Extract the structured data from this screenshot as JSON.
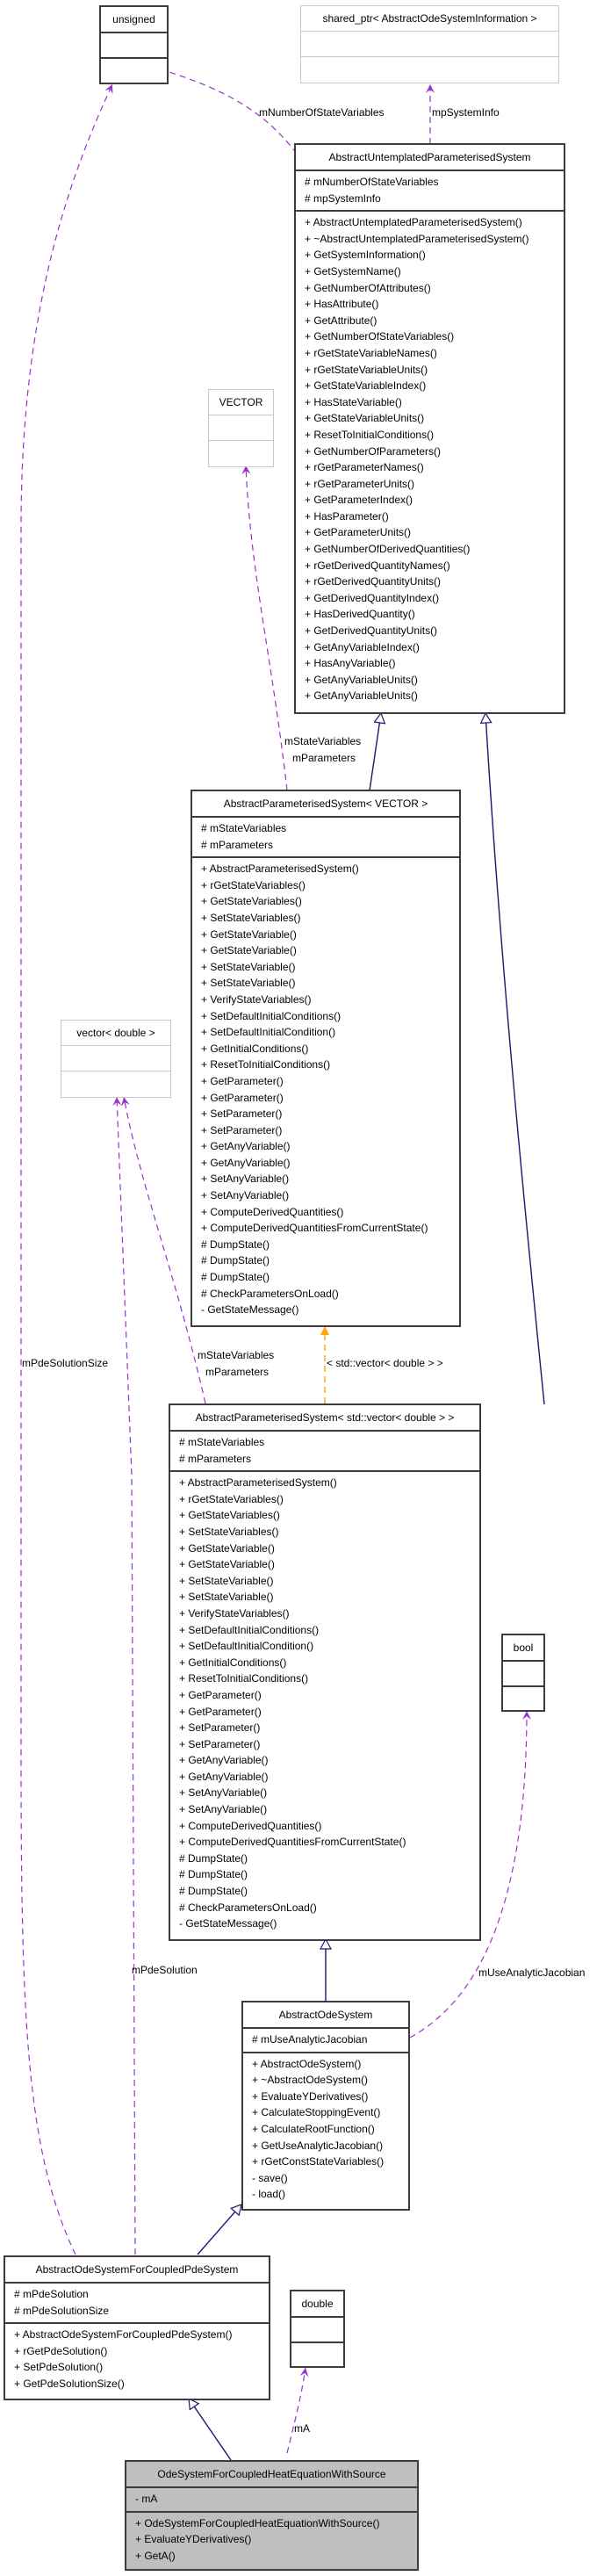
{
  "classes": {
    "unsigned": {
      "name": "unsigned",
      "attributes": [],
      "methods": []
    },
    "shared_ptr": {
      "name": "shared_ptr< AbstractOdeSystemInformation >",
      "attributes": [],
      "methods": []
    },
    "vector_tpl": {
      "name": "VECTOR",
      "attributes": [],
      "methods": []
    },
    "untemplated": {
      "name": "AbstractUntemplatedParameterisedSystem",
      "attributes": [
        "# mNumberOfStateVariables",
        "# mpSystemInfo"
      ],
      "methods": [
        "+ AbstractUntemplatedParameterisedSystem()",
        "+ ~AbstractUntemplatedParameterisedSystem()",
        "+ GetSystemInformation()",
        "+ GetSystemName()",
        "+ GetNumberOfAttributes()",
        "+ HasAttribute()",
        "+ GetAttribute()",
        "+ GetNumberOfStateVariables()",
        "+ rGetStateVariableNames()",
        "+ rGetStateVariableUnits()",
        "+ GetStateVariableIndex()",
        "+ HasStateVariable()",
        "+ GetStateVariableUnits()",
        "+ ResetToInitialConditions()",
        "+ GetNumberOfParameters()",
        "+ rGetParameterNames()",
        "+ rGetParameterUnits()",
        "+ GetParameterIndex()",
        "+ HasParameter()",
        "+ GetParameterUnits()",
        "+ GetNumberOfDerivedQuantities()",
        "+ rGetDerivedQuantityNames()",
        "+ rGetDerivedQuantityUnits()",
        "+ GetDerivedQuantityIndex()",
        "+ HasDerivedQuantity()",
        "+ GetDerivedQuantityUnits()",
        "+ GetAnyVariableIndex()",
        "+ HasAnyVariable()",
        "+ GetAnyVariableUnits()",
        "+ GetAnyVariableUnits()"
      ]
    },
    "param_vector": {
      "name": "AbstractParameterisedSystem< VECTOR >",
      "attributes": [
        "# mStateVariables",
        "# mParameters"
      ],
      "methods": [
        "+ AbstractParameterisedSystem()",
        "+ rGetStateVariables()",
        "+ GetStateVariables()",
        "+ SetStateVariables()",
        "+ GetStateVariable()",
        "+ GetStateVariable()",
        "+ SetStateVariable()",
        "+ SetStateVariable()",
        "+ VerifyStateVariables()",
        "+ SetDefaultInitialConditions()",
        "+ SetDefaultInitialCondition()",
        "+ GetInitialConditions()",
        "+ ResetToInitialConditions()",
        "+ GetParameter()",
        "+ GetParameter()",
        "+ SetParameter()",
        "+ SetParameter()",
        "+ GetAnyVariable()",
        "+ GetAnyVariable()",
        "+ SetAnyVariable()",
        "+ SetAnyVariable()",
        "+ ComputeDerivedQuantities()",
        "+ ComputeDerivedQuantitiesFromCurrentState()",
        "# DumpState()",
        "# DumpState()",
        "# DumpState()",
        "# CheckParametersOnLoad()",
        "- GetStateMessage()"
      ]
    },
    "vector_double": {
      "name": "vector< double >",
      "attributes": [],
      "methods": []
    },
    "param_stdvector": {
      "name": "AbstractParameterisedSystem< std::vector< double > >",
      "attributes": [
        "# mStateVariables",
        "# mParameters"
      ],
      "methods": [
        "+ AbstractParameterisedSystem()",
        "+ rGetStateVariables()",
        "+ GetStateVariables()",
        "+ SetStateVariables()",
        "+ GetStateVariable()",
        "+ GetStateVariable()",
        "+ SetStateVariable()",
        "+ SetStateVariable()",
        "+ VerifyStateVariables()",
        "+ SetDefaultInitialConditions()",
        "+ SetDefaultInitialCondition()",
        "+ GetInitialConditions()",
        "+ ResetToInitialConditions()",
        "+ GetParameter()",
        "+ GetParameter()",
        "+ SetParameter()",
        "+ SetParameter()",
        "+ GetAnyVariable()",
        "+ GetAnyVariable()",
        "+ SetAnyVariable()",
        "+ SetAnyVariable()",
        "+ ComputeDerivedQuantities()",
        "+ ComputeDerivedQuantitiesFromCurrentState()",
        "# DumpState()",
        "# DumpState()",
        "# DumpState()",
        "# CheckParametersOnLoad()",
        "- GetStateMessage()"
      ]
    },
    "bool": {
      "name": "bool",
      "attributes": [],
      "methods": []
    },
    "ode": {
      "name": "AbstractOdeSystem",
      "attributes": [
        "# mUseAnalyticJacobian"
      ],
      "methods": [
        "+ AbstractOdeSystem()",
        "+ ~AbstractOdeSystem()",
        "+ EvaluateYDerivatives()",
        "+ CalculateStoppingEvent()",
        "+ CalculateRootFunction()",
        "+ GetUseAnalyticJacobian()",
        "+ rGetConstStateVariables()",
        "- save()",
        "- load()"
      ]
    },
    "ode_pde": {
      "name": "AbstractOdeSystemForCoupledPdeSystem",
      "attributes": [
        "# mPdeSolution",
        "# mPdeSolutionSize"
      ],
      "methods": [
        "+ AbstractOdeSystemForCoupledPdeSystem()",
        "+ rGetPdeSolution()",
        "+ SetPdeSolution()",
        "+ GetPdeSolutionSize()"
      ]
    },
    "double": {
      "name": "double",
      "attributes": [],
      "methods": []
    },
    "heat": {
      "name": "OdeSystemForCoupledHeatEquationWithSource",
      "attributes": [
        "- mA"
      ],
      "methods": [
        "+ OdeSystemForCoupledHeatEquationWithSource()",
        "+ EvaluateYDerivatives()",
        "+ GetA()"
      ]
    }
  },
  "edge_labels": {
    "mNumberOfStateVariables": "mNumberOfStateVariables",
    "mpSystemInfo": "mpSystemInfo",
    "vector_tpl_1": "mStateVariables",
    "vector_tpl_2": "mParameters",
    "vector_double_1": "mStateVariables",
    "vector_double_2": "mParameters",
    "template_binding": "< std::vector< double > >",
    "mPdeSolutionSize": "mPdeSolutionSize",
    "mPdeSolution": "mPdeSolution",
    "mUseAnalyticJacobian": "mUseAnalyticJacobian",
    "mA": "mA"
  },
  "colors": {
    "inheritance": "#191970",
    "usage": "#9a32cd",
    "template": "#ffa500",
    "focus_fill": "#bfbfbf"
  }
}
